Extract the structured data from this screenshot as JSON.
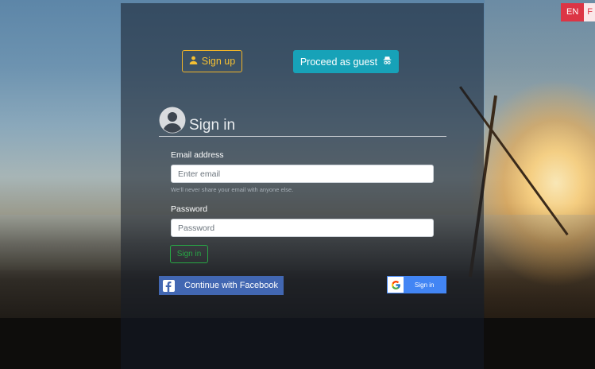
{
  "language": {
    "options": [
      "EN",
      "F"
    ],
    "selected": "EN"
  },
  "top_buttons": {
    "signup_label": "Sign up",
    "guest_label": "Proceed as guest"
  },
  "signin": {
    "title": "Sign in",
    "email": {
      "label": "Email address",
      "placeholder": "Enter email",
      "value": "",
      "help": "We'll never share your email with anyone else."
    },
    "password": {
      "label": "Password",
      "placeholder": "Password",
      "value": ""
    },
    "submit_label": "Sign in"
  },
  "social": {
    "facebook_label": "Continue with Facebook",
    "google_label": "Sign in"
  },
  "colors": {
    "signup": "#f0b429",
    "guest": "#17a2b8",
    "signin": "#28a745",
    "facebook": "#4267b2",
    "google": "#4285f4",
    "lang_active": "#dc3545"
  },
  "icons": {
    "signup": "user-icon",
    "guest": "incognito-icon",
    "signin": "user-circle-icon",
    "facebook": "facebook-icon",
    "google": "google-icon"
  }
}
